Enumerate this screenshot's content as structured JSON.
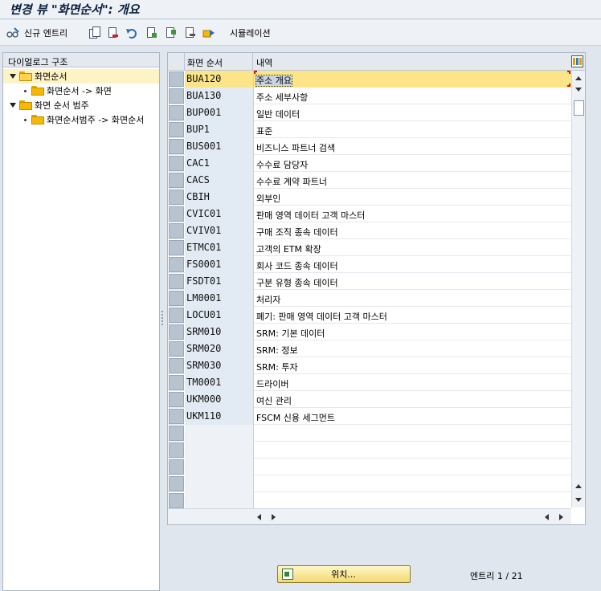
{
  "window": {
    "title": "변경 뷰 \"화면순서\": 개요"
  },
  "toolbar": {
    "new_entries_label": "신규 엔트리",
    "simulation_label": "시뮬레이션",
    "icons": [
      "glasses-edit-icon",
      "copy-icon",
      "delete-icon",
      "undo-icon",
      "select-all-icon",
      "select-block-icon",
      "deselect-all-icon",
      "transport-icon"
    ]
  },
  "tree": {
    "header": "다이얼로그 구조",
    "items": [
      {
        "label": "화면순서",
        "level": 0,
        "expanded": true,
        "selected": true
      },
      {
        "label": "화면순서 -> 화면",
        "level": 1
      },
      {
        "label": "화면 순서 범주",
        "level": 0,
        "expanded": true
      },
      {
        "label": "화면순서범주 -> 화면순서",
        "level": 1
      }
    ]
  },
  "table": {
    "columns": [
      "화면 순서",
      "내역"
    ],
    "rows": [
      {
        "code": "BUA120",
        "desc": "주소 개요"
      },
      {
        "code": "BUA130",
        "desc": "주소 세부사항"
      },
      {
        "code": "BUP001",
        "desc": "일반 데이터"
      },
      {
        "code": "BUP1",
        "desc": "표준"
      },
      {
        "code": "BUS001",
        "desc": "비즈니스 파트너 검색"
      },
      {
        "code": "CAC1",
        "desc": "수수료 담당자"
      },
      {
        "code": "CACS",
        "desc": "수수료 계약 파트너"
      },
      {
        "code": "CBIH",
        "desc": "외부인"
      },
      {
        "code": "CVIC01",
        "desc": "판매 영역 데이터 고객 마스터"
      },
      {
        "code": "CVIV01",
        "desc": "구매 조직 종속 데이터"
      },
      {
        "code": "ETMC01",
        "desc": "고객의 ETM 확장"
      },
      {
        "code": "FS0001",
        "desc": "회사 코드 종속 데이터"
      },
      {
        "code": "FSDT01",
        "desc": "구분 유형 종속 데이터"
      },
      {
        "code": "LM0001",
        "desc": "처리자"
      },
      {
        "code": "LOCU01",
        "desc": "폐기: 판매 영역 데이터 고객 마스터"
      },
      {
        "code": "SRM010",
        "desc": "SRM: 기본 데이터"
      },
      {
        "code": "SRM020",
        "desc": "SRM: 정보"
      },
      {
        "code": "SRM030",
        "desc": "SRM: 투자"
      },
      {
        "code": "TM0001",
        "desc": "드라이버"
      },
      {
        "code": "UKM000",
        "desc": "여신 관리"
      },
      {
        "code": "UKM110",
        "desc": "FSCM 신용 세그먼트"
      }
    ],
    "empty_rows": 5
  },
  "footer": {
    "position_label": "위치...",
    "entry_label": "엔트리",
    "entry_count": "1 / 21"
  }
}
